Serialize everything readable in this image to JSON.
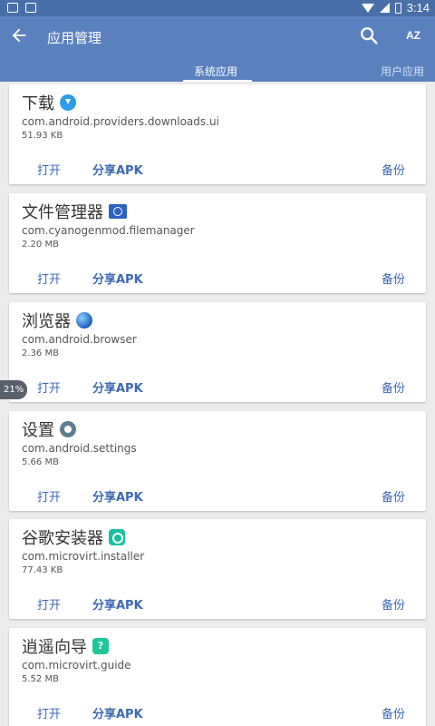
{
  "statusbar": {
    "time": "3:14"
  },
  "appbar": {
    "title": "应用管理",
    "sort_label": "AZ"
  },
  "tabs": [
    {
      "label": "系统应用"
    },
    {
      "label": "用户应用"
    }
  ],
  "floating_badge": "21%",
  "apps": [
    {
      "name": "下载",
      "package": "com.android.providers.downloads.ui",
      "size": "51.93 KB",
      "icon": "download-icon",
      "open": "打开",
      "share": "分享APK",
      "backup": "备份"
    },
    {
      "name": "文件管理器",
      "package": "com.cyanogenmod.filemanager",
      "size": "2.20 MB",
      "icon": "folder-icon",
      "open": "打开",
      "share": "分享APK",
      "backup": "备份"
    },
    {
      "name": "浏览器",
      "package": "com.android.browser",
      "size": "2.36 MB",
      "icon": "globe-icon",
      "open": "打开",
      "share": "分享APK",
      "backup": "备份"
    },
    {
      "name": "设置",
      "package": "com.android.settings",
      "size": "5.66 MB",
      "icon": "gear-icon",
      "open": "打开",
      "share": "分享APK",
      "backup": "备份"
    },
    {
      "name": "谷歌安装器",
      "package": "com.microvirt.installer",
      "size": "77.43 KB",
      "icon": "installer-icon",
      "open": "打开",
      "share": "分享APK",
      "backup": "备份"
    },
    {
      "name": "逍遥向导",
      "package": "com.microvirt.guide",
      "size": "5.52 MB",
      "icon": "guide-icon",
      "open": "打开",
      "share": "分享APK",
      "backup": "备份"
    }
  ]
}
